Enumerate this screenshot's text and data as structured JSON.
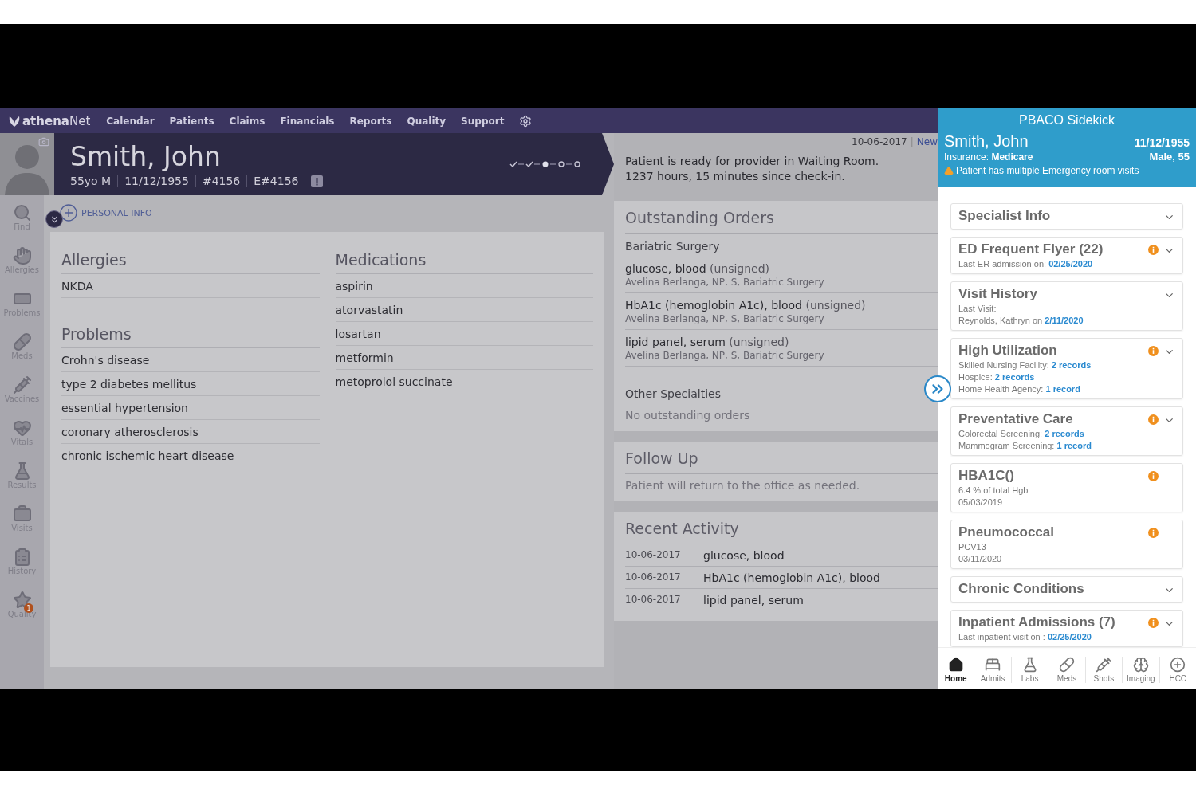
{
  "top_nav": {
    "logo": "**athena**Net",
    "items": [
      "Calendar",
      "Patients",
      "Claims",
      "Financials",
      "Reports",
      "Quality",
      "Support"
    ]
  },
  "patient_header": {
    "name": "Smith, John",
    "age_sex": "55yo M",
    "dob": "11/12/1955",
    "patient_id": "#4156",
    "enterprise_id": "E#4156",
    "workflow_steps": [
      {
        "completed": true,
        "current": false
      },
      {
        "completed": true,
        "current": false
      },
      {
        "completed": false,
        "current": true
      },
      {
        "completed": false,
        "current": false
      },
      {
        "completed": false,
        "current": false
      }
    ]
  },
  "encounter": {
    "date": "10-06-2017",
    "separator": "|",
    "link": "New",
    "status_lines": [
      "Patient is ready for provider in Waiting Room.",
      "1237 hours, 15 minutes since check-in."
    ]
  },
  "rail": [
    {
      "label": "Find"
    },
    {
      "label": "Allergies"
    },
    {
      "label": "Problems"
    },
    {
      "label": "Meds"
    },
    {
      "label": "Vaccines"
    },
    {
      "label": "Vitals"
    },
    {
      "label": "Results"
    },
    {
      "label": "Visits"
    },
    {
      "label": "History"
    },
    {
      "label": "Quality",
      "badge": "1"
    }
  ],
  "personal_info": "PERSONAL INFO",
  "allergies": {
    "title": "Allergies",
    "items": [
      "NKDA"
    ]
  },
  "problems": {
    "title": "Problems",
    "items": [
      "Crohn's disease",
      "type 2 diabetes mellitus",
      "essential hypertension",
      "coronary atherosclerosis",
      "chronic ischemic heart disease"
    ]
  },
  "medications": {
    "title": "Medications",
    "items": [
      "aspirin",
      "atorvastatin",
      "losartan",
      "metformin",
      "metoprolol succinate"
    ]
  },
  "outstanding_orders": {
    "title": "Outstanding Orders",
    "groups": [
      {
        "name": "Bariatric Surgery",
        "orders": [
          {
            "name": "glucose, blood",
            "status": "(unsigned)",
            "provider": "Avelina Berlanga, NP, S, Bariatric Surgery"
          },
          {
            "name": "HbA1c (hemoglobin A1c), blood",
            "status": "(unsigned)",
            "provider": "Avelina Berlanga, NP, S, Bariatric Surgery"
          },
          {
            "name": "lipid panel, serum",
            "status": "(unsigned)",
            "provider": "Avelina Berlanga, NP, S, Bariatric Surgery"
          }
        ]
      },
      {
        "name": "Other Specialties",
        "empty_text": "No outstanding orders"
      }
    ]
  },
  "follow_up": {
    "title": "Follow Up",
    "text": "Patient will return to the office as needed."
  },
  "recent_activity": {
    "title": "Recent Activity",
    "rows": [
      {
        "date": "10-06-2017",
        "name": "glucose, blood"
      },
      {
        "date": "10-06-2017",
        "name": "HbA1c (hemoglobin A1c), blood"
      },
      {
        "date": "10-06-2017",
        "name": "lipid panel, serum"
      }
    ]
  },
  "sidekick": {
    "title": "PBACO Sidekick",
    "patient_name": "Smith, John",
    "dob": "11/12/1955",
    "insurance_label": "Insurance:",
    "insurance": "Medicare",
    "sex_age": "Male, 55",
    "alert": "Patient has multiple Emergency room visits",
    "cards": [
      {
        "title": "Specialist Info",
        "flag": false,
        "expandable": true
      },
      {
        "title": "ED Frequent Flyer (22)",
        "flag": true,
        "expandable": true,
        "lines": [
          {
            "label": "Last ER admission on:",
            "value": "02/25/2020"
          }
        ]
      },
      {
        "title": "Visit History",
        "flag": false,
        "expandable": true,
        "lines": [
          {
            "label": "Last Visit:"
          },
          {
            "label": "Reynolds, Kathryn on",
            "value": "2/11/2020"
          }
        ]
      },
      {
        "title": "High Utilization",
        "flag": true,
        "expandable": true,
        "lines": [
          {
            "label": "Skilled Nursing Facility:",
            "value": "2 records"
          },
          {
            "label": "Hospice:",
            "value": "2 records"
          },
          {
            "label": "Home Health Agency:",
            "value": "1 record"
          }
        ]
      },
      {
        "title": "Preventative Care",
        "flag": true,
        "expandable": true,
        "lines": [
          {
            "label": "Colorectal Screening:",
            "value": "2 records"
          },
          {
            "label": "Mammogram Screening:",
            "value": "1 record"
          }
        ]
      },
      {
        "title": "HBA1C()",
        "flag": true,
        "expandable": false,
        "lines": [
          {
            "label": "6.4 % of total Hgb"
          },
          {
            "label": "05/03/2019"
          }
        ]
      },
      {
        "title": "Pneumococcal",
        "flag": true,
        "expandable": false,
        "lines": [
          {
            "label": "PCV13"
          },
          {
            "label": "03/11/2020"
          }
        ]
      },
      {
        "title": "Chronic Conditions",
        "flag": false,
        "expandable": true
      },
      {
        "title": "Inpatient Admissions (7)",
        "flag": true,
        "expandable": true,
        "lines": [
          {
            "label": "Last inpatient visit on :",
            "value": "02/25/2020"
          }
        ]
      }
    ],
    "bottom_nav": [
      {
        "label": "Home",
        "selected": true
      },
      {
        "label": "Admits",
        "selected": false
      },
      {
        "label": "Labs",
        "selected": false
      },
      {
        "label": "Meds",
        "selected": false
      },
      {
        "label": "Shots",
        "selected": false
      },
      {
        "label": "Imaging",
        "selected": false
      },
      {
        "label": "HCC",
        "selected": false
      }
    ]
  }
}
